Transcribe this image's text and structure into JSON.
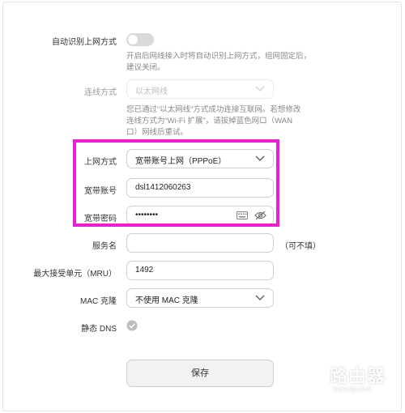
{
  "auto_detect": {
    "label": "自动识别上网方式",
    "enabled": false,
    "hint_line1": "开启后网线接入时将自动识别上网方式，组网固定后，",
    "hint_line2": "建议关闭。"
  },
  "connection_method": {
    "label": "连线方式",
    "value": "以太网线",
    "hint_line1": "您已通过“以太网线”方式成功连接互联网。若想修改",
    "hint_line2": "连线方式为“Wi-Fi 扩展”，请拔掉蓝色网口（WAN",
    "hint_line3": "口）网线后重试。"
  },
  "internet_method": {
    "label": "上网方式",
    "value": "宽带账号上网（PPPoE）"
  },
  "broadband_account": {
    "label": "宽带账号",
    "value": "dsl1412060263"
  },
  "broadband_password": {
    "label": "宽带密码",
    "value": "••••••••"
  },
  "service_name": {
    "label": "服务名",
    "value": "",
    "suffix": "（可不填）"
  },
  "mru": {
    "label": "最大接受单元（MRU）",
    "value": "1492"
  },
  "mac_clone": {
    "label": "MAC 克隆",
    "value": "不使用 MAC 克隆"
  },
  "static_dns": {
    "label": "静态 DNS",
    "checked": true
  },
  "save_label": "保存",
  "colors": {
    "highlight": "#e81ed9",
    "toggle_off": "#d9d9d9"
  },
  "watermark": {
    "text": "路由器",
    "sub": "luyouqi.com"
  }
}
